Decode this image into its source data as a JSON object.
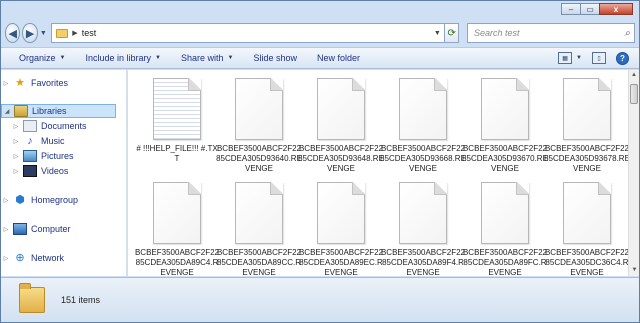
{
  "window": {
    "caption_buttons": {
      "minimize": "–",
      "maximize": "▭",
      "close": "x"
    }
  },
  "address": {
    "crumbs": [
      "test"
    ],
    "search_placeholder": "Search test"
  },
  "toolbar": {
    "items": [
      "Organize",
      "Include in library",
      "Share with",
      "Slide show",
      "New folder"
    ]
  },
  "nav": {
    "favorites": "Favorites",
    "libraries": "Libraries",
    "library_items": [
      "Documents",
      "Music",
      "Pictures",
      "Videos"
    ],
    "homegroup": "Homegroup",
    "computer": "Computer",
    "network": "Network"
  },
  "files": [
    {
      "name": "# !!!HELP_FILE!!! #.TXT",
      "type": "txt"
    },
    {
      "name": "BCBEF3500ABCF2F2285CDEA305D93640.REVENGE",
      "type": "file"
    },
    {
      "name": "BCBEF3500ABCF2F2285CDEA305D93648.REVENGE",
      "type": "file"
    },
    {
      "name": "BCBEF3500ABCF2F2285CDEA305D93668.REVENGE",
      "type": "file"
    },
    {
      "name": "BCBEF3500ABCF2F2285CDEA305D93670.REVENGE",
      "type": "file"
    },
    {
      "name": "BCBEF3500ABCF2F2285CDEA305D93678.REVENGE",
      "type": "file"
    },
    {
      "name": "BCBEF3500ABCF2F2285CDEA305DA89C4.REVENGE",
      "type": "file"
    },
    {
      "name": "BCBEF3500ABCF2F2285CDEA305DA89CC.REVENGE",
      "type": "file"
    },
    {
      "name": "BCBEF3500ABCF2F2285CDEA305DA89EC.REVENGE",
      "type": "file"
    },
    {
      "name": "BCBEF3500ABCF2F2285CDEA305DA89F4.REVENGE",
      "type": "file"
    },
    {
      "name": "BCBEF3500ABCF2F2285CDEA305DA89FC.REVENGE",
      "type": "file"
    },
    {
      "name": "BCBEF3500ABCF2F2285CDEA305DC36C4.REVENGE",
      "type": "file"
    }
  ],
  "status": {
    "item_count": "151 items"
  }
}
